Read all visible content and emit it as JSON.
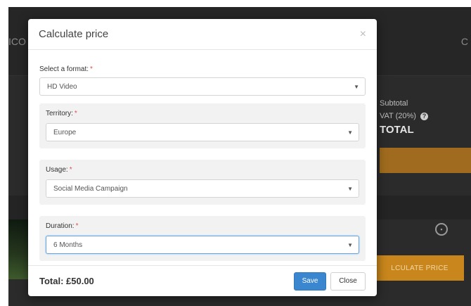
{
  "background": {
    "title_fragment": "ICO",
    "right_fragment": "C",
    "summary": {
      "subtotal_label": "Subtotal",
      "vat_label": "VAT (20%)",
      "total_label": "TOTAL"
    },
    "calculate_button_label": "LCULATE PRICE",
    "colors": {
      "accent": "#c8861c",
      "overlay": "#2b2b2b"
    }
  },
  "modal": {
    "title": "Calculate price",
    "close_glyph": "×",
    "fields": {
      "format": {
        "label": "Select a format:",
        "required_mark": "*",
        "value": "HD Video"
      },
      "territory": {
        "label": "Territory:",
        "required_mark": "*",
        "value": "Europe"
      },
      "usage": {
        "label": "Usage:",
        "required_mark": "*",
        "value": "Social Media Campaign"
      },
      "duration": {
        "label": "Duration:",
        "required_mark": "*",
        "value": "6 Months"
      }
    },
    "caret_glyph": "▼",
    "footer": {
      "total_text": "Total: £50.00",
      "save_label": "Save",
      "close_label": "Close"
    },
    "colors": {
      "primary": "#3a87cf",
      "required": "#d9534f"
    }
  }
}
